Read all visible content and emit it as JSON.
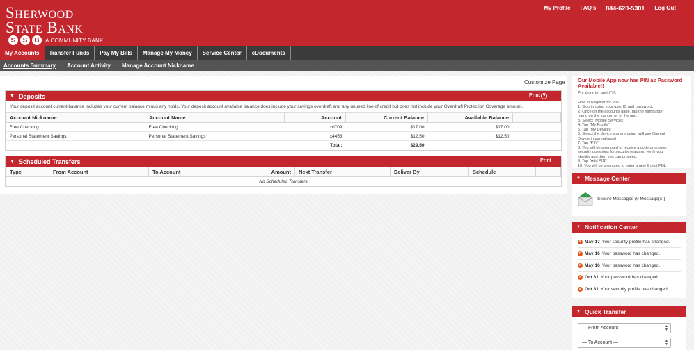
{
  "brand": {
    "line1": "Sherwood",
    "line2": "State Bank",
    "ssb": [
      "S",
      "S",
      "B"
    ],
    "tagline": "A COMMUNITY BANK",
    "accent": "#c4262e"
  },
  "toplinks": {
    "profile": "My Profile",
    "faqs": "FAQ's",
    "phone": "844-620-5301",
    "logout": "Log Out"
  },
  "mainnav": [
    {
      "label": "My Accounts",
      "active": true
    },
    {
      "label": "Transfer Funds"
    },
    {
      "label": "Pay My Bills"
    },
    {
      "label": "Manage My Money"
    },
    {
      "label": "Service Center"
    },
    {
      "label": "eDocuments"
    }
  ],
  "subnav": [
    {
      "label": "Accounts Summary",
      "active": true
    },
    {
      "label": "Account Activity"
    },
    {
      "label": "Manage Account Nickname"
    }
  ],
  "customize": "Customize Page",
  "deposits": {
    "title": "Deposits",
    "print": "Print",
    "notice": "Your deposit account current balance includes your current balance minus any holds. Your deposit account available balance does include your savings overdraft and any unused line of credit but does not include your Overdraft Protection Coverage amount.",
    "columns": [
      "Account Nickname",
      "Account Name",
      "Account",
      "Current Balance",
      "Available Balance"
    ],
    "rows": [
      {
        "nickname": "Free Checking",
        "name": "Free Checking",
        "account": "x0709",
        "current": "$17.00",
        "available": "$17.00"
      },
      {
        "nickname": "Personal Statement Savings",
        "name": "Personal Statement Savings",
        "account": "x4453",
        "current": "$12.50",
        "available": "$12.50"
      }
    ],
    "total_label": "Total:",
    "total_value": "$29.50"
  },
  "scheduled": {
    "title": "Scheduled Transfers",
    "print": "Print",
    "columns": [
      "Type",
      "From Account",
      "To Account",
      "Amount",
      "Next Transfer",
      "Deliver By",
      "Schedule"
    ],
    "empty": "No Scheduled Transfers"
  },
  "promo": {
    "heading": "Our Mobile App now has PIN as Password Available!!",
    "platforms": "For Android and IOS",
    "steps": [
      "How to Register for PIN",
      "1. Sign in using your user ID and password.",
      "2. Once on the accounts page, tap the hamburger",
      "menu on the top corner of the app.",
      "3. Select \"Mobile Services\"",
      "4. Tap \"My Profile\"",
      "5. Tap \"My Devices\"",
      "6. Select the device you are using (will say Current",
      "Device in parenthesis)",
      "7. Tap \"PIN\"",
      "8. You will be prompted to receive a code or answer",
      "security questions for security reasons, verify your",
      "identity and then you can proceed.",
      "9. Tap \"Add PIN\"",
      "10. You will be prompted to enter a new 6 digit PIN."
    ]
  },
  "message_center": {
    "title": "Message Center",
    "text": "Secure Messages (0 Message(s))"
  },
  "notification_center": {
    "title": "Notification Center",
    "items": [
      {
        "date": "May 17",
        "text": "Your security profile has changed."
      },
      {
        "date": "May 16",
        "text": "Your password has changed."
      },
      {
        "date": "May 16",
        "text": "Your password has changed."
      },
      {
        "date": "Oct 31",
        "text": "Your password has changed."
      },
      {
        "date": "Oct 31",
        "text": "Your security profile has changed."
      }
    ]
  },
  "quick_transfer": {
    "title": "Quick Transfer",
    "from": "— From Account —",
    "to": "— To Account —"
  }
}
